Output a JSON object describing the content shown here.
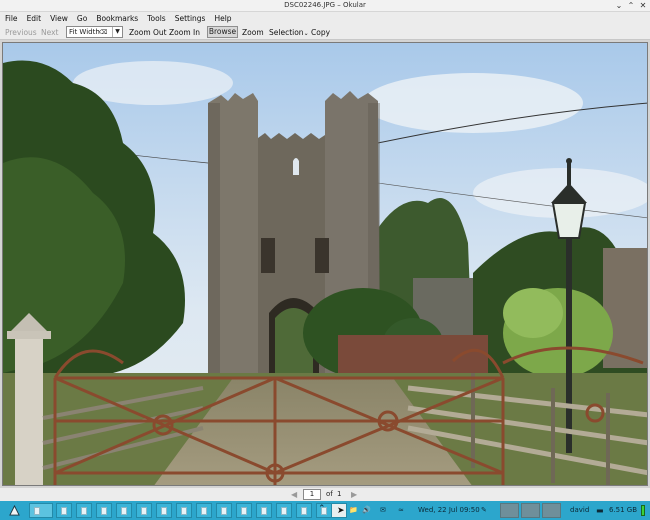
{
  "window": {
    "title": "DSC02246.JPG – Okular"
  },
  "menu": [
    "File",
    "Edit",
    "View",
    "Go",
    "Bookmarks",
    "Tools",
    "Settings",
    "Help"
  ],
  "toolbar": {
    "previous": "Previous",
    "next": "Next",
    "zoom_value": "Fit Width",
    "zoom_out": "Zoom Out",
    "zoom_in": "Zoom In",
    "browse": "Browse",
    "zoom": "Zoom",
    "selection": "Selection",
    "copy": "Copy"
  },
  "pagenav": {
    "current": "1",
    "of_label": "of",
    "total": "1"
  },
  "taskbar": {
    "clock": "Wed, 22 Jul  09:50",
    "user": "david",
    "disk": "6.51 GB"
  },
  "colors": {
    "taskbar": "#2ca6cc",
    "sky": "#cfe2f3"
  }
}
